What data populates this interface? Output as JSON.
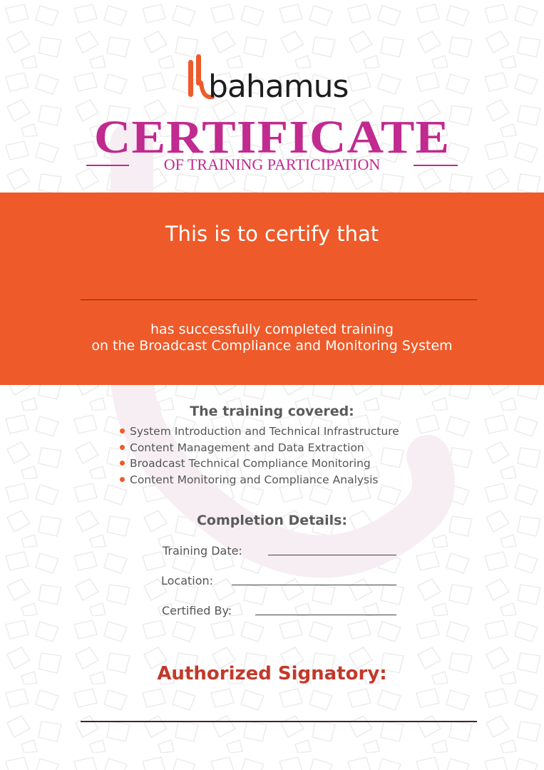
{
  "brand": {
    "name": "bahamus",
    "colors": {
      "orange": "#ee5a29",
      "magenta": "#c12a8f",
      "dark": "#1d1d1f",
      "signatory_red": "#c2392a"
    }
  },
  "certificate": {
    "title": "CERTIFICATE",
    "subtitle": "OF TRAINING PARTICIPATION"
  },
  "band": {
    "certify_text": "This is to certify that",
    "completed_line1": "has successfully completed training",
    "completed_line2": "on the Broadcast Compliance and Monitoring System"
  },
  "training": {
    "heading": "The training covered:",
    "topics": [
      "System Introduction and Technical Infrastructure",
      "Content Management and Data Extraction",
      "Broadcast Technical Compliance Monitoring",
      "Content Monitoring and Compliance Analysis"
    ]
  },
  "completion": {
    "heading": "Completion Details:",
    "training_date_label": "Training Date:",
    "location_label": "Location:",
    "certified_by_label": "Certified By:"
  },
  "signatory": {
    "label": "Authorized Signatory:"
  }
}
